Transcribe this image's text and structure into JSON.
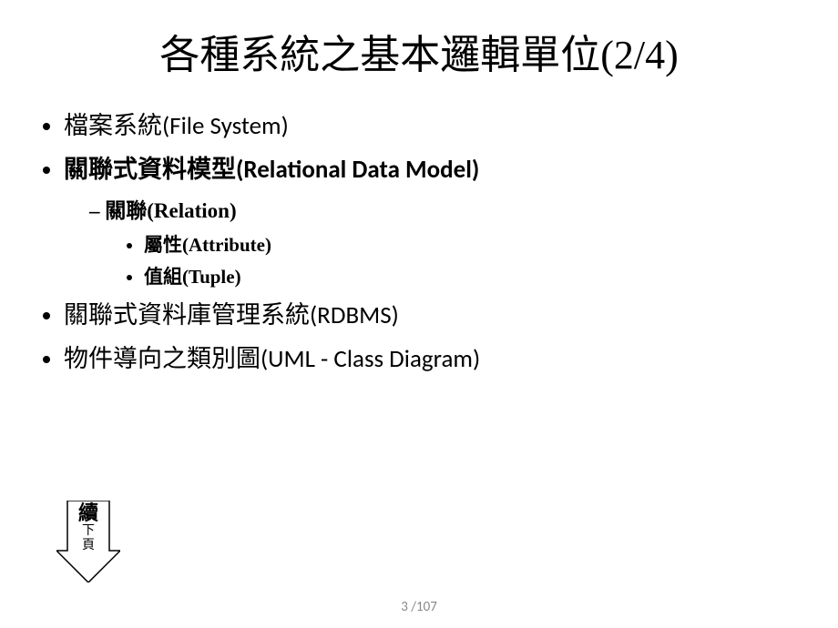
{
  "title": "各種系統之基本邏輯單位(2/4)",
  "bullets": {
    "b1": "檔案系統(File System)",
    "b2": "關聯式資料模型(Relational Data Model)",
    "b2_1": "關聯(Relation)",
    "b2_1_1": "屬性(Attribute)",
    "b2_1_2": "值組(Tuple)",
    "b3": "關聯式資料庫管理系統(RDBMS)",
    "b4": "物件導向之類別圖(UML - Class Diagram)"
  },
  "arrow": {
    "line1": "續",
    "line2": "下",
    "line3": "頁"
  },
  "pager": {
    "current": "3",
    "sep": " /",
    "total": "107"
  },
  "watermark": "."
}
